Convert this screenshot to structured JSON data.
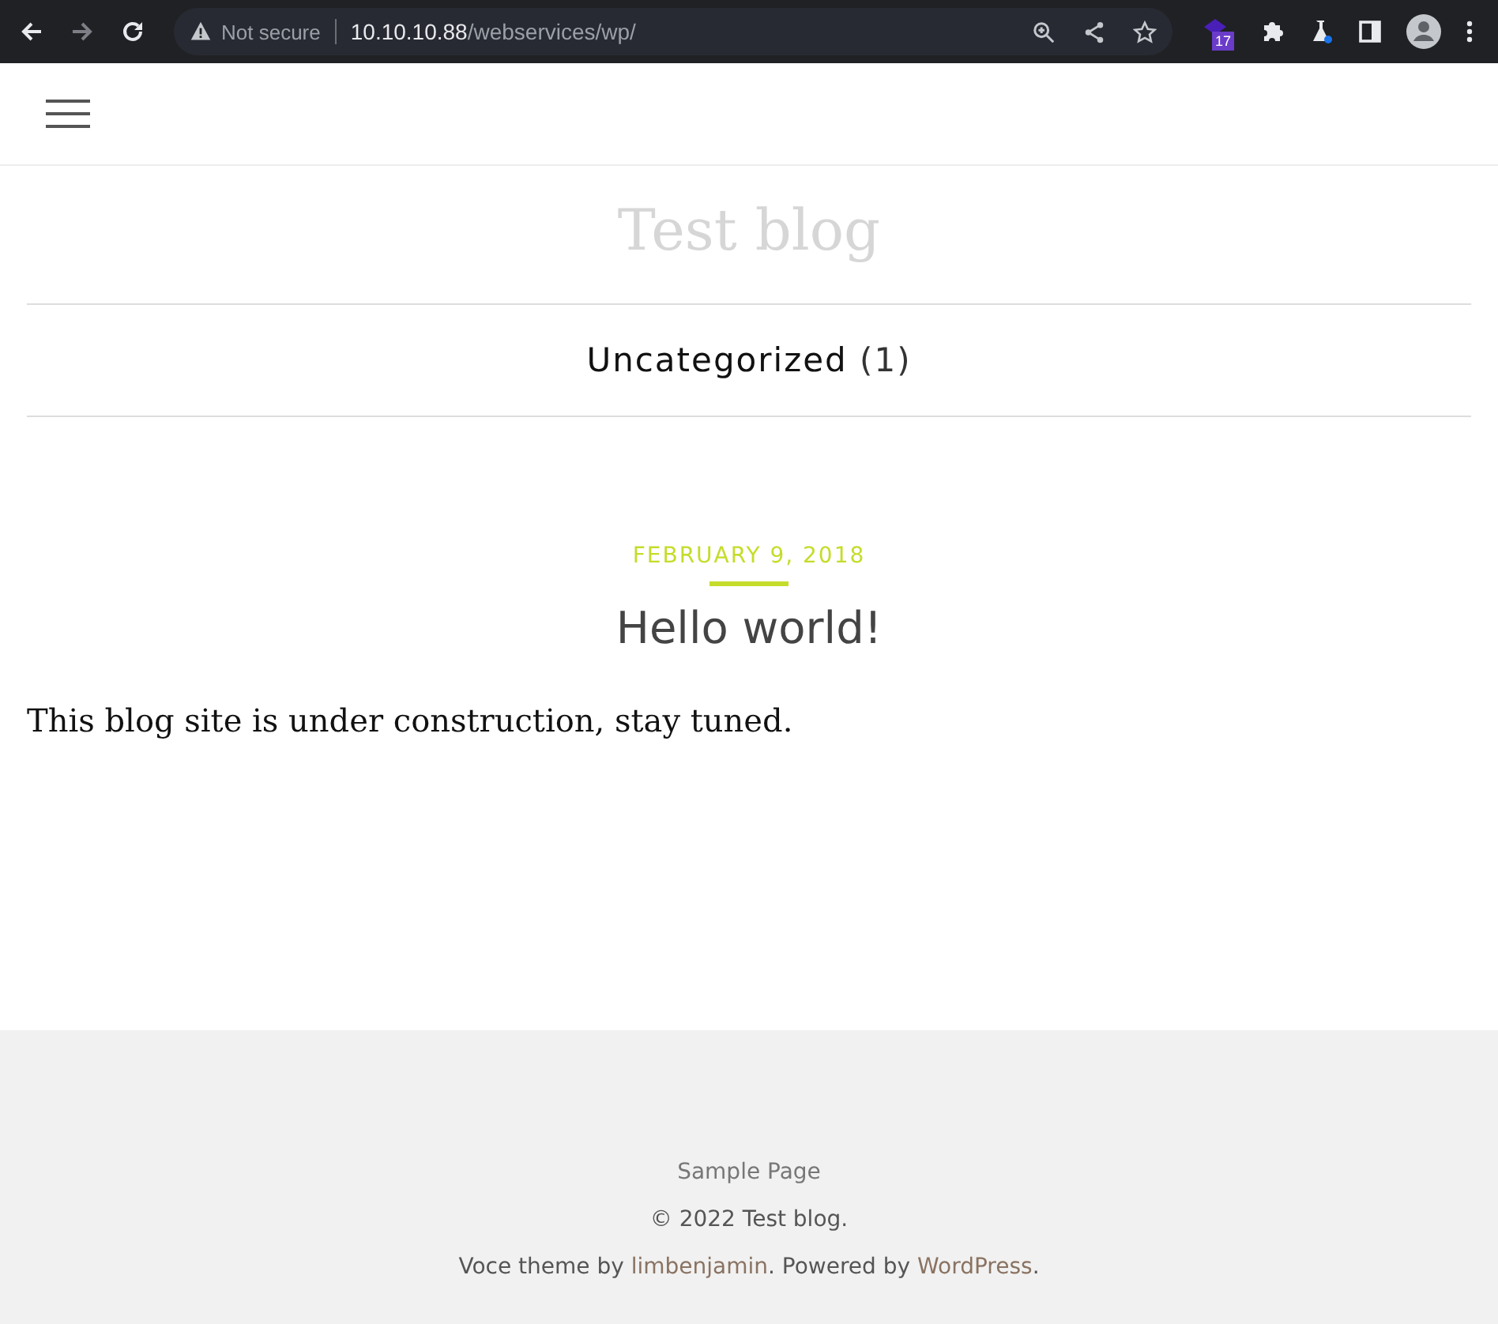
{
  "browser": {
    "security": "Not secure",
    "url_host": "10.10.10.88",
    "url_path": "/webservices/wp/",
    "extension_badge": "17"
  },
  "site": {
    "title": "Test blog"
  },
  "categories": [
    {
      "name": "Uncategorized",
      "count": "(1)"
    }
  ],
  "post": {
    "date": "FEBRUARY 9, 2018",
    "title": "Hello world!",
    "body": "This blog site is under construction, stay tuned."
  },
  "footer": {
    "menu": "Sample Page",
    "copyright": "© 2022 Test blog.",
    "credits": {
      "prefix": "Voce theme by ",
      "author_link": "limbenjamin",
      "middle": ". Powered by ",
      "wp_link": "WordPress",
      "suffix": "."
    }
  }
}
